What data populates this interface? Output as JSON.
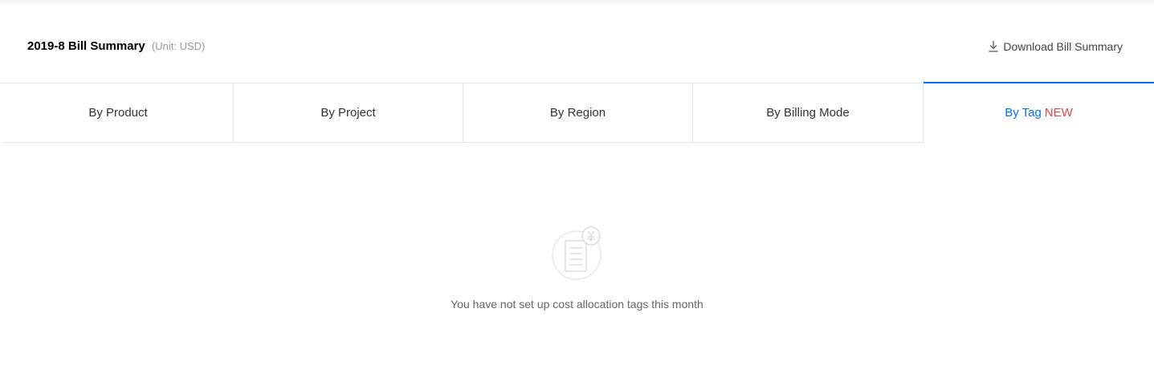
{
  "header": {
    "title": "2019-8 Bill Summary",
    "unit": "(Unit: USD)",
    "download_label": "Download Bill Summary",
    "download_icon": "download-icon"
  },
  "tabs": [
    {
      "label": "By Product",
      "active": false
    },
    {
      "label": "By Project",
      "active": false
    },
    {
      "label": "By Region",
      "active": false
    },
    {
      "label": "By Billing Mode",
      "active": false
    },
    {
      "label": "By Tag",
      "badge": "NEW",
      "active": true
    }
  ],
  "empty_state": {
    "icon": "bill-yen-icon",
    "message": "You have not set up cost allocation tags this month"
  },
  "colors": {
    "accent": "#006eff",
    "badge": "#e54545",
    "muted_text": "#999999",
    "border": "#e5e5e5"
  }
}
